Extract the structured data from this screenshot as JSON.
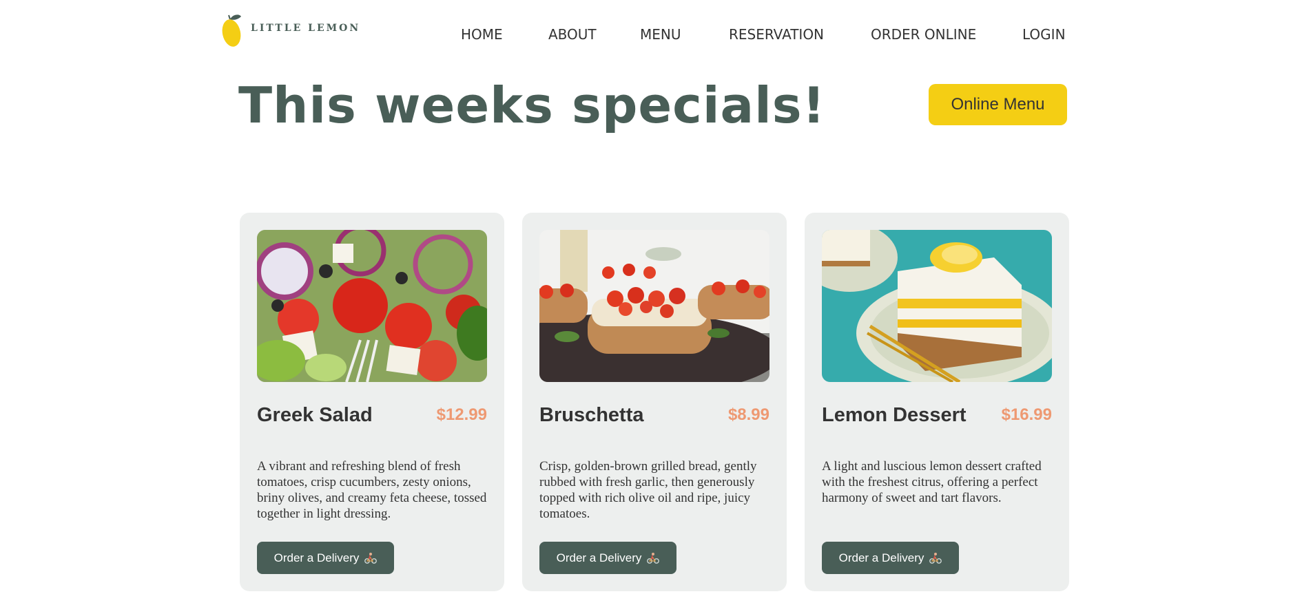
{
  "brand": {
    "name": "LITTLE LEMON"
  },
  "nav": {
    "items": [
      {
        "label": "HOME"
      },
      {
        "label": "ABOUT"
      },
      {
        "label": "MENU"
      },
      {
        "label": "RESERVATION"
      },
      {
        "label": "ORDER ONLINE"
      },
      {
        "label": "LOGIN"
      }
    ]
  },
  "specials": {
    "title": "This weeks specials!",
    "menu_button": "Online Menu"
  },
  "cards": [
    {
      "title": "Greek Salad",
      "price": "$12.99",
      "description": "A vibrant and refreshing blend of fresh tomatoes, crisp cucumbers, zesty onions, briny olives, and creamy feta cheese, tossed together in light dressing.",
      "button": "Order a Delivery",
      "icon": "delivery-bike-icon"
    },
    {
      "title": "Bruschetta",
      "price": "$8.99",
      "description": "Crisp, golden-brown grilled bread, gently rubbed with fresh garlic, then generously topped with rich olive oil and ripe, juicy tomatoes.",
      "button": "Order a Delivery",
      "icon": "delivery-bike-icon"
    },
    {
      "title": "Lemon Dessert",
      "price": "$16.99",
      "description": "A light and luscious lemon dessert crafted with the freshest citrus, offering a perfect harmony of sweet and tart flavors.",
      "button": "Order a Delivery",
      "icon": "delivery-bike-icon"
    }
  ],
  "colors": {
    "primary_green": "#495E57",
    "primary_yellow": "#F4CE14",
    "price_salmon": "#EE9972",
    "card_bg": "#EDEFEE"
  }
}
